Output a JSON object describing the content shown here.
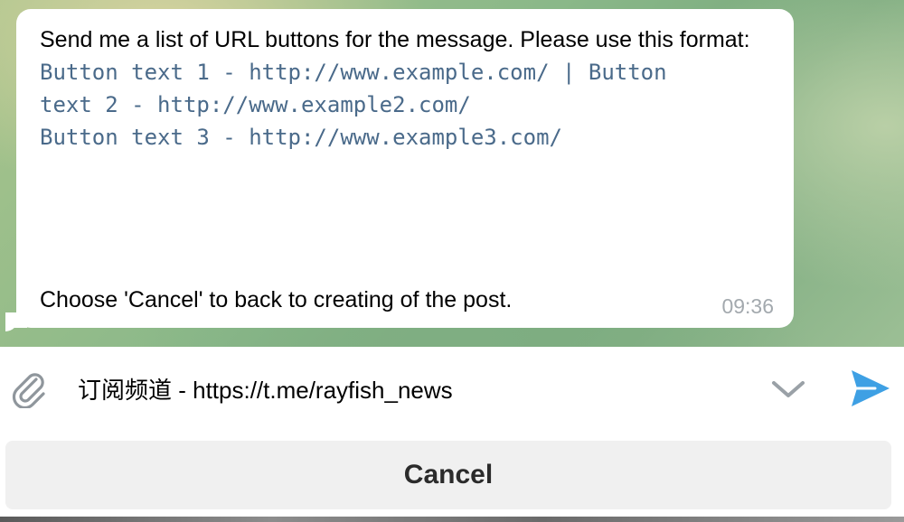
{
  "message": {
    "intro": "Send me a list of URL buttons for the message. Please use this format:",
    "code_lines": [
      "Button text 1 - http://www.example.com/ | Button",
      "text 2 - http://www.example2.com/",
      "Button text 3 - http://www.example3.com/"
    ],
    "footer": "Choose 'Cancel' to back to creating of the post.",
    "time": "09:36"
  },
  "composer": {
    "value": "订阅频道 - https://t.me/rayfish_news",
    "attach_icon": "paperclip-icon",
    "chevron_icon": "chevron-down-icon",
    "send_icon": "send-icon",
    "accent_color": "#3ea0e4"
  },
  "keyboard": {
    "cancel_label": "Cancel"
  }
}
